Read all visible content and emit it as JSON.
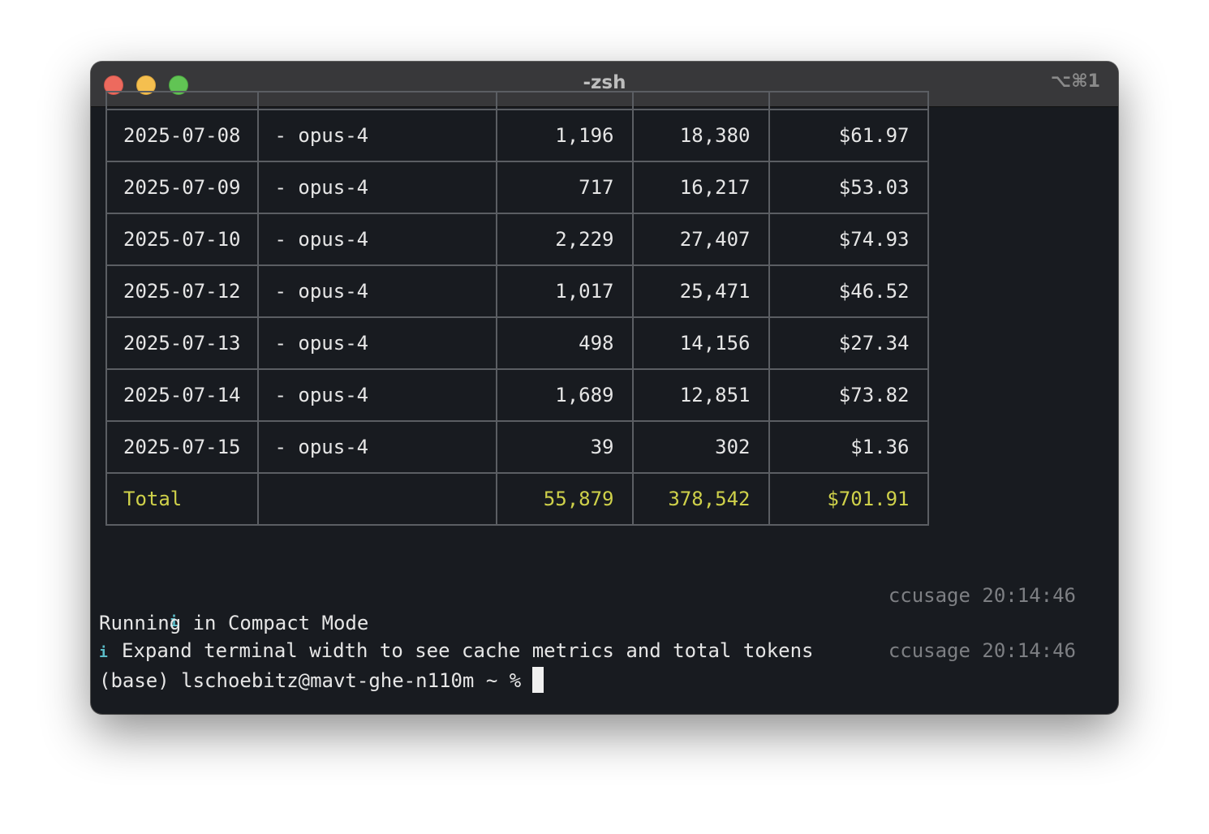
{
  "window": {
    "title": "-zsh",
    "shortcut": "⌥⌘1"
  },
  "table": {
    "rows": [
      {
        "date": "2025-07-08",
        "model": "- opus-4",
        "input": "1,196",
        "output": "18,380",
        "cost": "$61.97"
      },
      {
        "date": "2025-07-09",
        "model": "- opus-4",
        "input": "717",
        "output": "16,217",
        "cost": "$53.03"
      },
      {
        "date": "2025-07-10",
        "model": "- opus-4",
        "input": "2,229",
        "output": "27,407",
        "cost": "$74.93"
      },
      {
        "date": "2025-07-12",
        "model": "- opus-4",
        "input": "1,017",
        "output": "25,471",
        "cost": "$46.52"
      },
      {
        "date": "2025-07-13",
        "model": "- opus-4",
        "input": "498",
        "output": "14,156",
        "cost": "$27.34"
      },
      {
        "date": "2025-07-14",
        "model": "- opus-4",
        "input": "1,689",
        "output": "12,851",
        "cost": "$73.82"
      },
      {
        "date": "2025-07-15",
        "model": "- opus-4",
        "input": "39",
        "output": "302",
        "cost": "$1.36"
      }
    ],
    "total": {
      "label": "Total",
      "model": "",
      "input": "55,879",
      "output": "378,542",
      "cost": "$701.91"
    }
  },
  "log": {
    "info_icon": "i",
    "timestamp1": "ccusage 20:14:46",
    "line1": "Running in Compact Mode",
    "line2": "Expand terminal width to see cache metrics and total tokens",
    "timestamp2": "ccusage 20:14:46",
    "prompt": "(base) lschoebitz@mavt-ghe-n110m ~ %"
  },
  "colors": {
    "total_row": "#cfd14a",
    "info_icon": "#5bbcc8",
    "timestamp": "#7d7f83",
    "background": "#181b20"
  }
}
